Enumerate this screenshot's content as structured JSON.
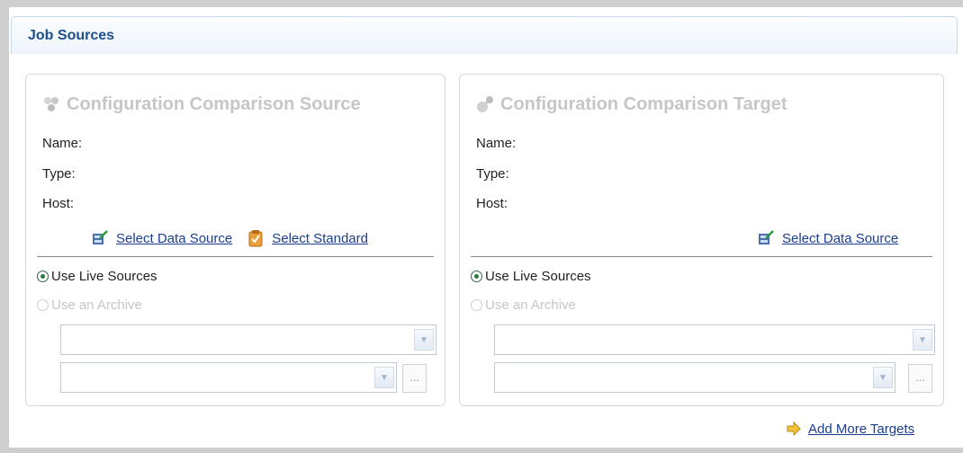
{
  "section": {
    "title": "Job Sources"
  },
  "source_panel": {
    "title": "Configuration Comparison Source",
    "title_icon": "puzzle-icon",
    "name_label": "Name:",
    "type_label": "Type:",
    "host_label": "Host:",
    "select_data_source": "Select Data Source",
    "select_standard": "Select Standard",
    "use_live_sources": "Use Live Sources",
    "use_archive": "Use an Archive",
    "use_live_sources_checked": true,
    "ellipsis_label": "..."
  },
  "target_panel": {
    "title": "Configuration Comparison Target",
    "title_icon": "target-icon",
    "name_label": "Name:",
    "type_label": "Type:",
    "host_label": "Host:",
    "select_data_source": "Select Data Source",
    "use_live_sources": "Use Live Sources",
    "use_archive": "Use an Archive",
    "use_live_sources_checked": true,
    "ellipsis_label": "..."
  },
  "footer": {
    "add_more_targets": "Add More Targets"
  },
  "colors": {
    "link": "#1a3d8f",
    "section_title": "#1c4f8c",
    "disabled_text": "#c6c6c6",
    "radio_checked": "#2a7a3a"
  }
}
